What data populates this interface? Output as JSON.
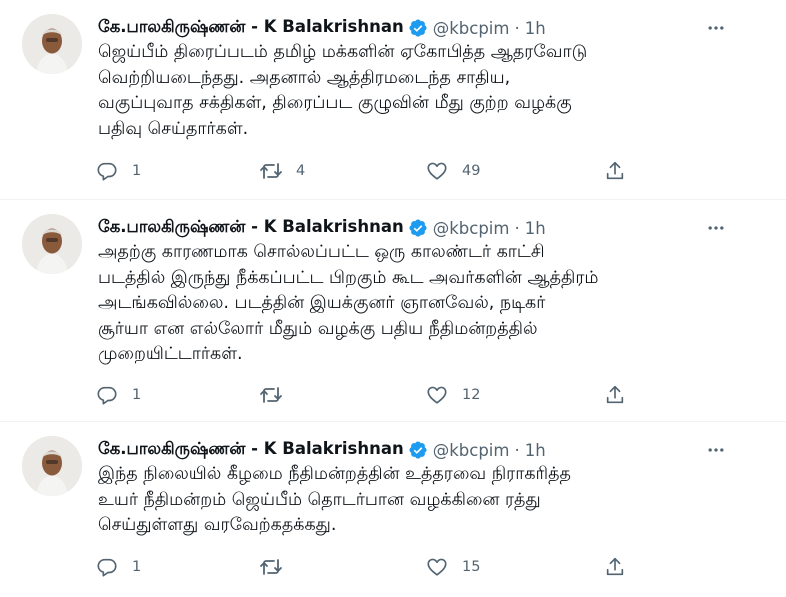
{
  "tweets": [
    {
      "author_name": "கே.பாலகிருஷ்ணன் - K Balakrishnan",
      "handle": "@kbcpim",
      "separator": "·",
      "time": "1h",
      "lines": [
        "ஜெய்பீம் திரைப்படம் தமிழ் மக்களின் ஏகோபித்த ஆதரவோடு",
        "வெற்றியடைந்தது. அதனால் ஆத்திரமடைந்த சாதிய,",
        "வகுப்புவாத சக்திகள், திரைப்பட குழுவின் மீது குற்ற வழக்கு",
        "பதிவு செய்தார்கள்."
      ],
      "reply_count": "1",
      "retweet_count": "4",
      "like_count": "49"
    },
    {
      "author_name": "கே.பாலகிருஷ்ணன் - K Balakrishnan",
      "handle": "@kbcpim",
      "separator": "·",
      "time": "1h",
      "lines": [
        "அதற்கு காரணமாக சொல்லப்பட்ட ஒரு காலண்டர் காட்சி",
        "படத்தில் இருந்து நீக்கப்பட்ட பிறகும் கூட அவர்களின் ஆத்திரம்",
        "அடங்கவில்லை. படத்தின் இயக்குனர் ஞானவேல், நடிகர்",
        "சூர்யா என எல்லோர் மீதும் வழக்கு பதிய நீதிமன்றத்தில்",
        "முறையிட்டார்கள்."
      ],
      "reply_count": "1",
      "retweet_count": "",
      "like_count": "12"
    },
    {
      "author_name": "கே.பாலகிருஷ்ணன் - K Balakrishnan",
      "handle": "@kbcpim",
      "separator": "·",
      "time": "1h",
      "lines": [
        "இந்த நிலையில் கீழமை நீதிமன்றத்தின் உத்தரவை நிராகரித்த",
        "உயர் நீதிமன்றம் ஜெய்பீம் தொடர்பான வழக்கினை ரத்து",
        "செய்துள்ளது வரவேற்கதக்கது."
      ],
      "reply_count": "1",
      "retweet_count": "",
      "like_count": "15"
    }
  ],
  "icons": {
    "verified": "verified-badge-icon",
    "more": "more-dots-icon",
    "reply": "reply-bubble-icon",
    "retweet": "retweet-arrows-icon",
    "like": "heart-icon",
    "share": "share-upload-icon"
  },
  "colors": {
    "text": "#0f1419",
    "muted": "#536471",
    "verified": "#1d9bf0",
    "divider": "#eff3f4"
  }
}
